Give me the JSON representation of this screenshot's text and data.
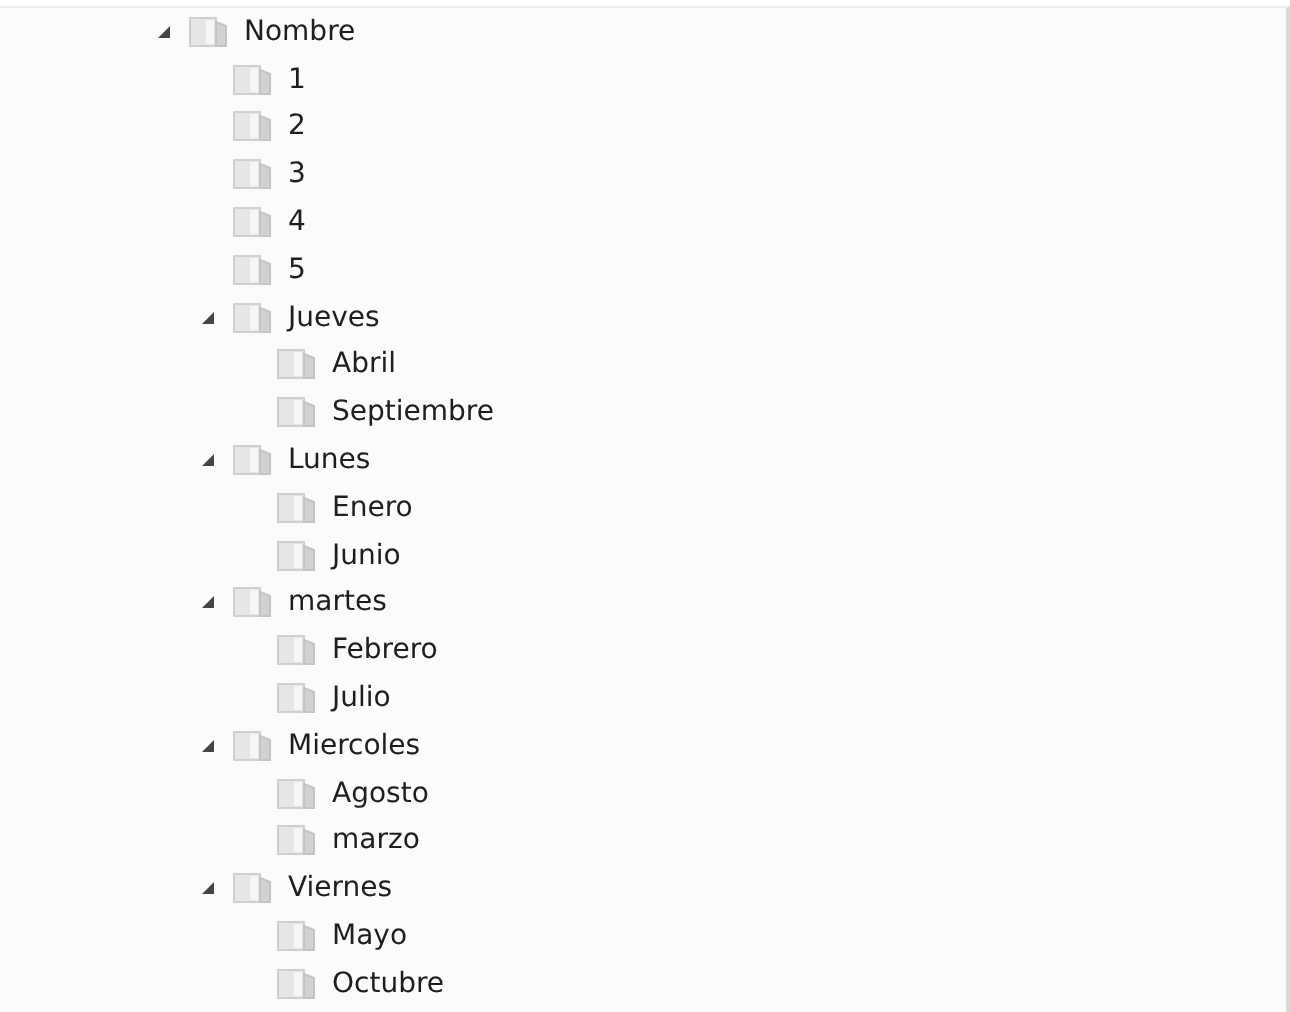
{
  "tree": [
    {
      "label": "Nombre",
      "expanded": true,
      "children": [
        {
          "label": "1"
        },
        {
          "label": "2"
        },
        {
          "label": "3"
        },
        {
          "label": "4"
        },
        {
          "label": "5"
        },
        {
          "label": "Jueves",
          "expanded": true,
          "children": [
            {
              "label": "Abril"
            },
            {
              "label": "Septiembre"
            }
          ]
        },
        {
          "label": "Lunes",
          "expanded": true,
          "children": [
            {
              "label": "Enero"
            },
            {
              "label": "Junio"
            }
          ]
        },
        {
          "label": "martes",
          "expanded": true,
          "children": [
            {
              "label": "Febrero"
            },
            {
              "label": "Julio"
            }
          ]
        },
        {
          "label": "Miercoles",
          "expanded": true,
          "children": [
            {
              "label": "Agosto"
            },
            {
              "label": "marzo"
            }
          ]
        },
        {
          "label": "Viernes",
          "expanded": true,
          "children": [
            {
              "label": "Mayo"
            },
            {
              "label": "Octubre"
            }
          ]
        }
      ]
    }
  ]
}
